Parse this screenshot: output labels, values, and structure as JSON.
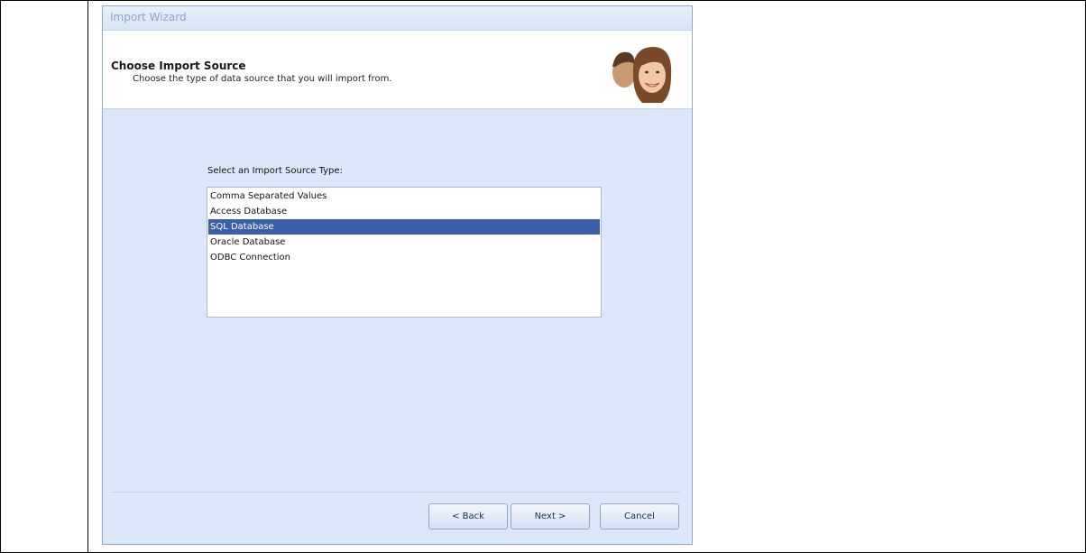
{
  "window": {
    "title": "Import Wizard"
  },
  "header": {
    "title": "Choose Import Source",
    "subtitle": "Choose the type of data source that you will import from."
  },
  "source_list": {
    "label": "Select an Import Source Type:",
    "items": [
      {
        "label": "Comma Separated Values",
        "selected": false
      },
      {
        "label": "Access Database",
        "selected": false
      },
      {
        "label": "SQL Database",
        "selected": true
      },
      {
        "label": "Oracle Database",
        "selected": false
      },
      {
        "label": "ODBC Connection",
        "selected": false
      }
    ]
  },
  "buttons": {
    "back": "< Back",
    "next": "Next >",
    "cancel": "Cancel"
  },
  "colors": {
    "selection": "#3a5fa8",
    "body_background": "#dce8fa"
  }
}
